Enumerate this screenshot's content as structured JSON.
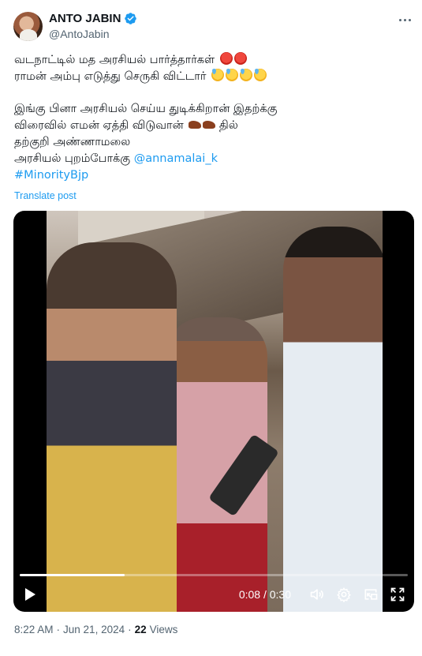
{
  "author": {
    "display_name": "ANTO JABIN",
    "handle": "@AntoJabin",
    "verified": true,
    "verified_color": "#1d9bf0"
  },
  "tweet": {
    "lines": [
      "வடநாட்டில் மத அரசியல் பார்த்தார்கள்",
      "ராமன் அம்பு எடுத்து செருகி விட்டார்",
      "இங்கு பினா அரசியல் செய்ய துடிக்கிறான் இதற்க்கு",
      "விரைவில் எமன் ஏத்தி விடுவான்",
      "தில்",
      "தற்குறி அண்ணாமலை",
      "அரசியல் புறம்போக்கு",
      "@annamalai_k",
      "#MinorityBjp"
    ],
    "emoji_names": [
      "angry-face",
      "grinning-sweat-face",
      "high-heel-shoe"
    ]
  },
  "translate_label": "Translate post",
  "video": {
    "current_time": "0:08",
    "duration": "0:30",
    "progress_fraction": 0.27
  },
  "meta": {
    "time": "8:22 AM",
    "separator1": "·",
    "date": "Jun 21, 2024",
    "separator2": "·",
    "views_count": "22",
    "views_label": "Views"
  },
  "colors": {
    "link": "#1d9bf0",
    "secondary_text": "#536471",
    "primary_text": "#0f1419"
  }
}
